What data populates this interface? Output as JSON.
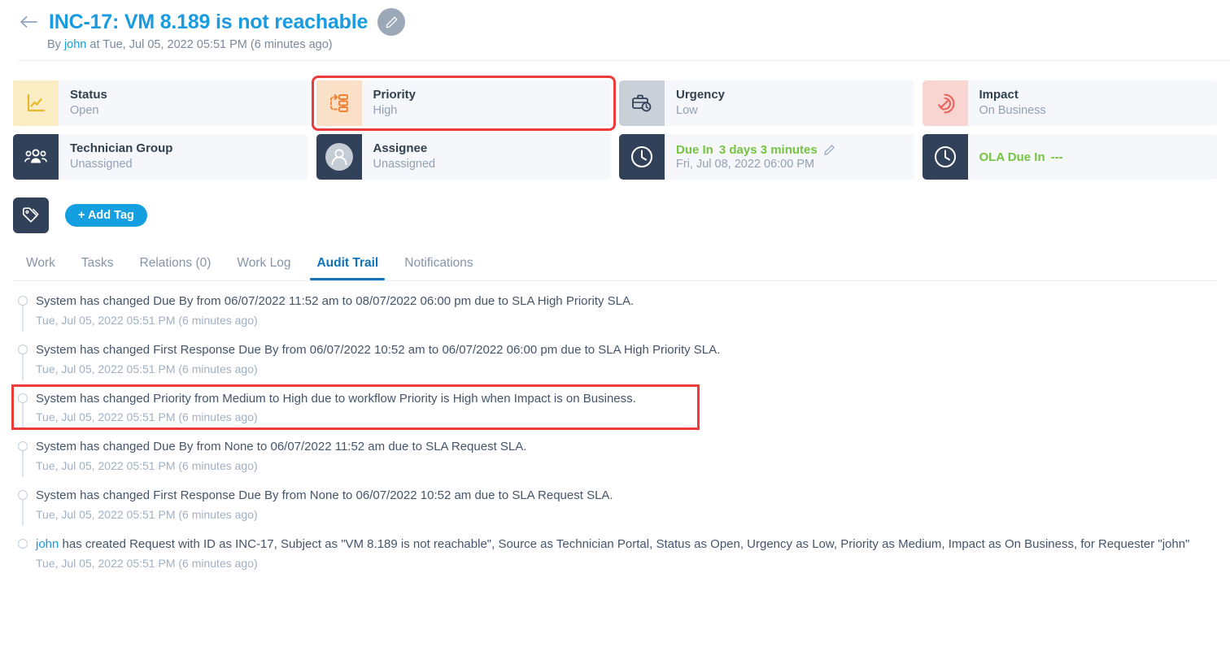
{
  "header": {
    "back_icon": "arrow-left-icon",
    "ticket_title": "INC-17: VM 8.189 is not reachable",
    "edit_icon": "pencil-icon",
    "meta_prefix": "By ",
    "meta_user": "john",
    "meta_suffix": " at Tue, Jul 05, 2022 05:51 PM (6 minutes ago)"
  },
  "cards": {
    "row1": [
      {
        "label": "Status",
        "value": "Open",
        "icon": "chart-line-icon",
        "icon_style": "ic-status",
        "highlighted": false
      },
      {
        "label": "Priority",
        "value": "High",
        "icon": "workflow-icon",
        "icon_style": "ic-priority",
        "highlighted": true
      },
      {
        "label": "Urgency",
        "value": "Low",
        "icon": "briefcase-clock-icon",
        "icon_style": "ic-urgency",
        "highlighted": false
      },
      {
        "label": "Impact",
        "value": "On Business",
        "icon": "target-arrow-icon",
        "icon_style": "ic-impact",
        "highlighted": false
      }
    ],
    "row2": [
      {
        "label": "Technician Group",
        "value": "Unassigned",
        "icon": "users-group-icon",
        "icon_style": "ic-dark"
      },
      {
        "label": "Assignee",
        "value": "Unassigned",
        "icon": "user-avatar-icon",
        "icon_style": "ic-dark"
      }
    ],
    "due_in": {
      "label": "Due In",
      "value": "3 days 3 minutes",
      "sub": "Fri, Jul 08, 2022 06:00 PM",
      "icon": "clock-icon",
      "edit_icon": "pencil-icon"
    },
    "ola_due_in": {
      "label": "OLA Due In",
      "value": "---",
      "icon": "clock-icon"
    }
  },
  "tags": {
    "tag_icon": "tags-icon",
    "add_tag_label": "+  Add Tag"
  },
  "tabs": [
    {
      "label": "Work",
      "active": false
    },
    {
      "label": "Tasks",
      "active": false
    },
    {
      "label": "Relations (0)",
      "active": false
    },
    {
      "label": "Work Log",
      "active": false
    },
    {
      "label": "Audit Trail",
      "active": true
    },
    {
      "label": "Notifications",
      "active": false
    }
  ],
  "audit_trail": [
    {
      "text": "System has changed Due By from 06/07/2022 11:52 am to 08/07/2022 06:00 pm due to SLA High Priority SLA.",
      "time": "Tue, Jul 05, 2022 05:51 PM (6 minutes ago)",
      "highlighted": false
    },
    {
      "text": "System has changed First Response Due By from 06/07/2022 10:52 am to 06/07/2022 06:00 pm due to SLA High Priority SLA.",
      "time": "Tue, Jul 05, 2022 05:51 PM (6 minutes ago)",
      "highlighted": false
    },
    {
      "text": "System has changed Priority from Medium to High due to workflow Priority is High when Impact is on Business.",
      "time": "Tue, Jul 05, 2022 05:51 PM (6 minutes ago)",
      "highlighted": true
    },
    {
      "text": "System has changed Due By from None to 06/07/2022 11:52 am due to SLA Request SLA.",
      "time": "Tue, Jul 05, 2022 05:51 PM (6 minutes ago)",
      "highlighted": false
    },
    {
      "text": "System has changed First Response Due By from None to 06/07/2022 10:52 am due to SLA Request SLA.",
      "time": "Tue, Jul 05, 2022 05:51 PM (6 minutes ago)",
      "highlighted": false
    },
    {
      "user": "john",
      "text": " has created Request with ID as INC-17, Subject as \"VM 8.189 is not reachable\", Source as Technician Portal, Status as Open, Urgency as Low, Priority as Medium, Impact as On Business, for Requester \"john\"",
      "time": "Tue, Jul 05, 2022 05:51 PM (6 minutes ago)",
      "highlighted": false
    }
  ],
  "colors": {
    "accent_blue": "#1a9be0",
    "tab_active": "#1173b8",
    "green": "#76c442",
    "annotation_red": "#ed3a3a",
    "dark_navy": "#31415a"
  }
}
